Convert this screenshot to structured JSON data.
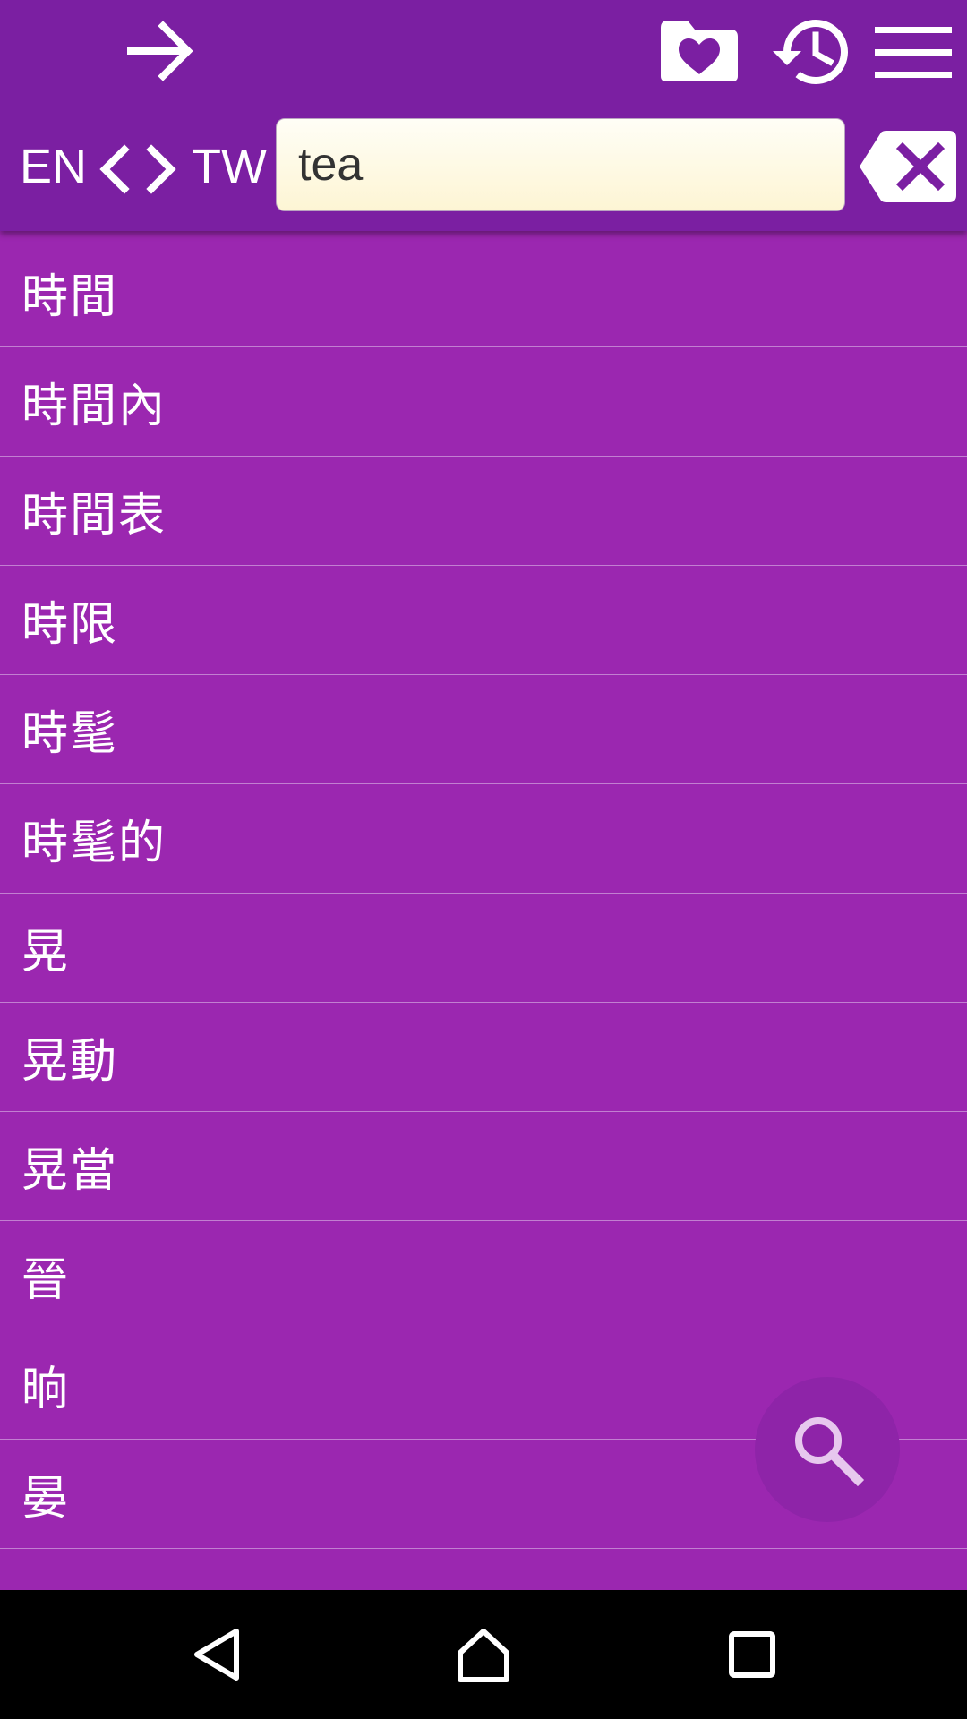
{
  "toolbar": {
    "back_icon": "arrow-right-icon",
    "favorites_icon": "folder-heart-icon",
    "history_icon": "history-icon",
    "menu_icon": "hamburger-menu-icon"
  },
  "language": {
    "source": "EN",
    "target": "TW"
  },
  "search": {
    "value": "tea",
    "clear_icon": "backspace-clear-icon"
  },
  "results": [
    "時間",
    "時間內",
    "時間表",
    "時限",
    "時髦",
    "時髦的",
    "晃",
    "晃動",
    "晃當",
    "晉",
    "晌",
    "晏"
  ],
  "fab": {
    "icon": "search-icon"
  },
  "navbar": {
    "back_icon": "nav-back-icon",
    "home_icon": "nav-home-icon",
    "recents_icon": "nav-recents-icon"
  },
  "colors": {
    "toolbar": "#7b1fa2",
    "background": "#9b27b0",
    "fab": "#8e24a8",
    "input_bg": "#fdf5d4"
  }
}
